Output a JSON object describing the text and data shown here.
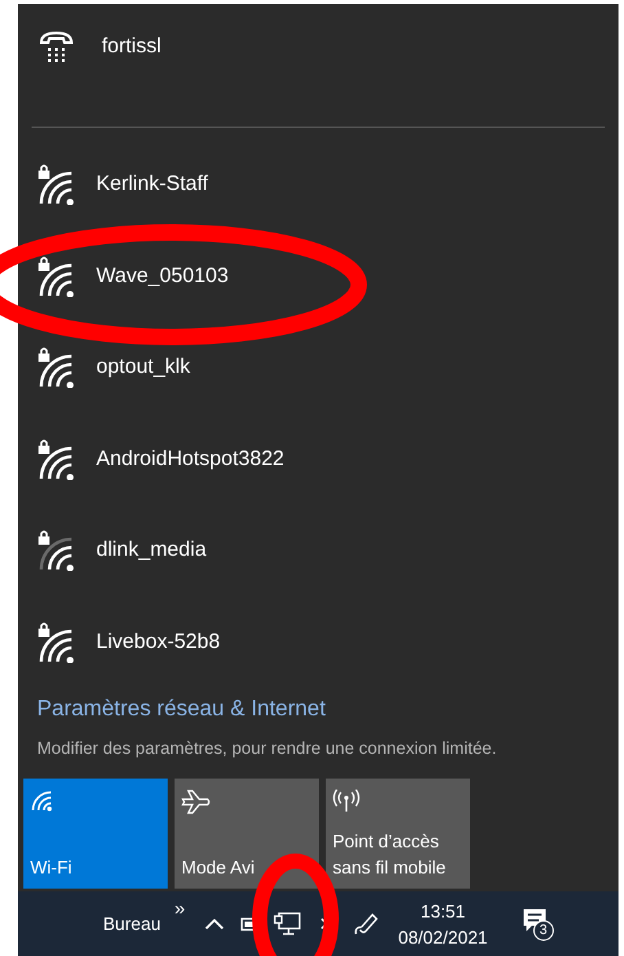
{
  "vpn": {
    "name": "fortissl"
  },
  "networks": [
    {
      "name": "Kerlink-Staff",
      "secured": true,
      "weak_signal": false
    },
    {
      "name": "Wave_050103",
      "secured": true,
      "weak_signal": false
    },
    {
      "name": "optout_klk",
      "secured": true,
      "weak_signal": false
    },
    {
      "name": "AndroidHotspot3822",
      "secured": true,
      "weak_signal": false
    },
    {
      "name": "dlink_media",
      "secured": true,
      "weak_signal": true
    },
    {
      "name": "Livebox-52b8",
      "secured": true,
      "weak_signal": false
    }
  ],
  "settings_link": "Paramètres réseau & Internet",
  "settings_hint": "Modifier des paramètres, pour rendre une connexion limitée.",
  "tiles": [
    {
      "kind": "wifi",
      "label": "Wi-Fi",
      "on": true
    },
    {
      "kind": "airplane",
      "label": "Mode Avi",
      "on": false
    },
    {
      "kind": "hotspot",
      "label": "Point d’accès sans fil mobile",
      "on": false
    }
  ],
  "taskbar": {
    "toolbar": "Bureau",
    "toolbar_chevron": "»",
    "time": "13:51",
    "date": "08/02/2021",
    "notification_count": "3"
  }
}
